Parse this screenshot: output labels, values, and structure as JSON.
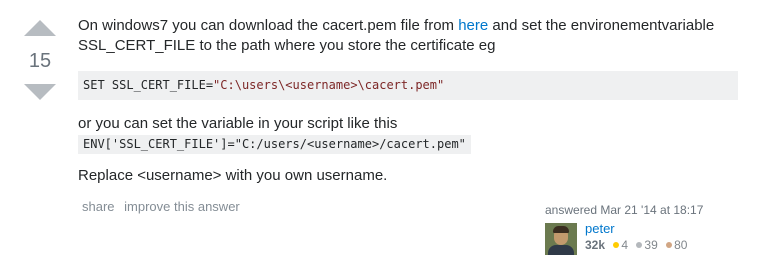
{
  "vote": {
    "count": "15"
  },
  "post": {
    "p1_text_before_link": "On windows7 you can download the cacert.pem file from ",
    "p1_link": "here",
    "p1_text_after_link": " and set the environementvariable SSL_CERT_FILE to the path where you store the certificate eg",
    "code_block_prefix": "SET SSL_CERT_FILE=",
    "code_block_string": "\"C:\\users\\<username>\\cacert.pem\"",
    "p2_text": "or you can set the variable in your script like this",
    "inline_code": "ENV['SSL_CERT_FILE']=\"C:/users/<username>/cacert.pem\"",
    "p3_text": "Replace <username> with you own username."
  },
  "menu": {
    "share": "share",
    "improve": "improve this answer"
  },
  "user": {
    "action_time": "answered Mar 21 '14 at 18:17",
    "name": "peter",
    "reputation": "32k",
    "gold": "4",
    "silver": "39",
    "bronze": "80",
    "colors": {
      "gold": "#ffcc01",
      "silver": "#b4b8bc",
      "bronze": "#d1a684"
    }
  }
}
